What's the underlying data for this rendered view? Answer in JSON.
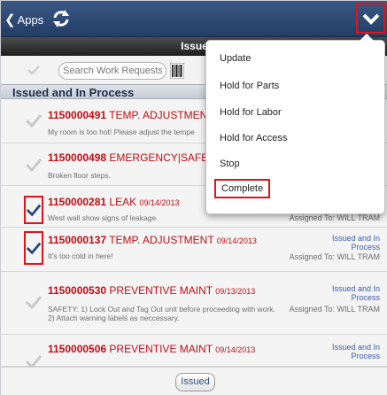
{
  "nav": {
    "back_label": "Apps",
    "refresh_icon": "refresh-icon",
    "menu_icon": "chevron-down-icon"
  },
  "subheader": {
    "title": "Issue"
  },
  "search": {
    "placeholder": "Search Work Requests"
  },
  "section": {
    "title": "Issued and In Process"
  },
  "rows": [
    {
      "wo": "1150000491",
      "type": "TEMP. ADJUSTMENT",
      "date": "",
      "desc": "My room is too hot! Please adjust the tempe",
      "status": "",
      "assigned": ""
    },
    {
      "wo": "1150000498",
      "type": "EMERGENCY|SAFETY",
      "date": "",
      "desc": "Broken floor steps.",
      "status": "",
      "assigned": ""
    },
    {
      "wo": "1150000281",
      "type": "LEAK",
      "date": "09/14/2013",
      "desc": "West wall show signs of leakage.",
      "status": "",
      "assigned": "Assigned To: WILL TRAM"
    },
    {
      "wo": "1150000137",
      "type": "TEMP. ADJUSTMENT",
      "date": "09/14/2013",
      "desc": "It's too cold in here!",
      "status": "Issued and In Process",
      "assigned": "Assigned To: WILL TRAM"
    },
    {
      "wo": "1150000530",
      "type": "PREVENTIVE MAINT",
      "date": "09/13/2013",
      "desc": "SAFETY: 1) Lock Out and Tag Out unit before proceeding with work. 2) Attach warning labels as neccessary.",
      "status": "Issued and In Process",
      "assigned": "Assigned To: WILL TRAM"
    },
    {
      "wo": "1150000506",
      "type": "PREVENTIVE MAINT",
      "date": "09/14/2013",
      "desc": "",
      "status": "Issued and In Process",
      "assigned": ""
    }
  ],
  "bottom": {
    "issued_label": "Issued"
  },
  "menu": {
    "items": [
      "Update",
      "Hold for Parts",
      "Hold for Labor",
      "Hold for Access",
      "Stop",
      "Complete"
    ]
  },
  "colors": {
    "nav_bar": "#2c4670",
    "work_order_red": "#c00d14",
    "status_blue": "#3a5bb0",
    "highlight_red": "#e0121b",
    "check_selected": "#21467f",
    "check_unselected": "#c9c9c9"
  }
}
